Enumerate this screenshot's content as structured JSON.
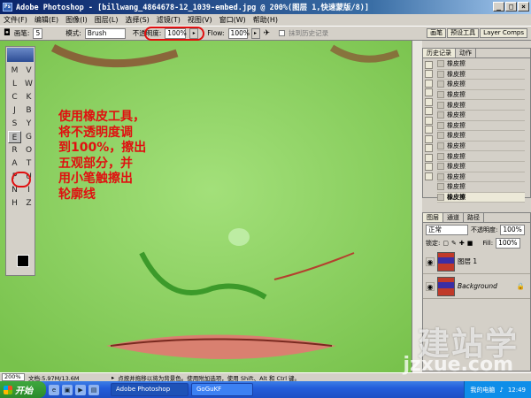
{
  "window": {
    "title": "Adobe Photoshop - [billwang_4864678-12_1039-embed.jpg @ 200%(图层 1,快速蒙版/8)]",
    "app_icon": "Ps",
    "controls": [
      "_",
      "□",
      "×"
    ]
  },
  "menu": [
    "文件(F)",
    "编辑(E)",
    "图像(I)",
    "图层(L)",
    "选择(S)",
    "滤镜(T)",
    "视图(V)",
    "窗口(W)",
    "帮助(H)"
  ],
  "options_bar": {
    "brush_label": "画笔:",
    "brush_size": "5",
    "mode_label": "模式:",
    "mode_value": "Brush",
    "opacity_label": "不透明度:",
    "opacity_value": "100%",
    "flow_label": "Flow:",
    "flow_value": "100%",
    "erase_history_label": "抹到历史记录",
    "palette_tabs": [
      "画笔",
      "预设工具",
      "Layer Comps"
    ]
  },
  "toolbox": {
    "tools": [
      "M",
      "V",
      "L",
      "W",
      "C",
      "K",
      "J",
      "B",
      "S",
      "Y",
      "E",
      "G",
      "R",
      "O",
      "A",
      "T",
      "P",
      "U",
      "N",
      "I",
      "H",
      "Z"
    ],
    "active_tool": "eraser",
    "foreground_color": "#000000",
    "background_color": "#ffffff"
  },
  "annotation": {
    "lines": [
      "使用橡皮工具，",
      "将不透明度调",
      "到100%，擦出",
      "五观部分，并",
      "用小笔触擦出",
      "轮廓线"
    ],
    "color": "#e01010"
  },
  "history_panel": {
    "tabs": [
      "历史记录",
      "动作"
    ],
    "items": [
      "橡皮擦",
      "橡皮擦",
      "橡皮擦",
      "橡皮擦",
      "橡皮擦",
      "橡皮擦",
      "橡皮擦",
      "橡皮擦",
      "橡皮擦",
      "橡皮擦",
      "橡皮擦",
      "橡皮擦",
      "橡皮擦",
      "橡皮擦"
    ]
  },
  "layers_panel": {
    "tabs": [
      "图层",
      "通道",
      "路径"
    ],
    "blend_mode": "正常",
    "opacity_label": "不透明度:",
    "opacity_value": "100%",
    "lock_label": "锁定:",
    "fill_label": "Fill:",
    "fill_value": "100%",
    "layers": [
      {
        "name": "图层 1",
        "active": false
      },
      {
        "name": "Background",
        "active": false
      }
    ]
  },
  "status_bar": {
    "zoom": "200%",
    "doc_size": "文档:5.97M/13.6M",
    "hint": "点按并拖移以将为背景色。使用附加选项，使用 Shift、Alt 和 Ctrl 键。"
  },
  "watermark": {
    "main": "建站学",
    "sub": "jzxue.com"
  },
  "taskbar": {
    "start_label": "开始",
    "tasks": [
      "Adobe Photoshop",
      "GoGuKF"
    ],
    "tray_text": "我的电脑",
    "clock": "12:49"
  },
  "colors": {
    "canvas_green": "#8fd664",
    "highlight_red": "#e01010"
  }
}
